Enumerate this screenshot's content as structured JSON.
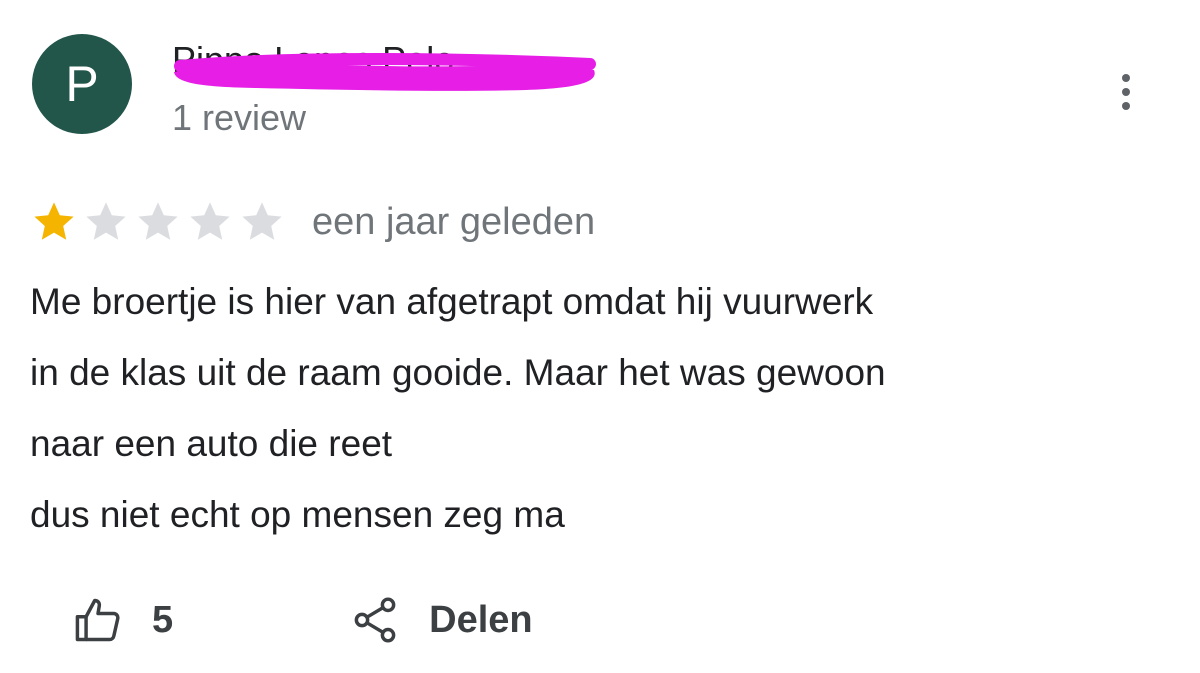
{
  "review": {
    "avatar_initial": "P",
    "avatar_color": "#22564a",
    "reviewer_name": "Pippo Lopes Pelo",
    "review_count": "1 review",
    "rating": 1,
    "max_rating": 5,
    "star_filled_color": "#f4b400",
    "star_empty_color": "#dadce0",
    "date": "een jaar geleden",
    "text_lines": [
      "Me broertje is hier van afgetrapt omdat hij vuurwerk",
      "in de klas uit de raam gooide. Maar het was gewoon",
      "naar een auto die reet",
      "dus niet echt op mensen zeg ma"
    ],
    "redaction_color": "#e61ee6"
  },
  "actions": {
    "like_icon": "thumbs-up-icon",
    "like_count": "5",
    "share_icon": "share-icon",
    "share_label": "Delen",
    "more_icon": "more-vertical-icon"
  }
}
